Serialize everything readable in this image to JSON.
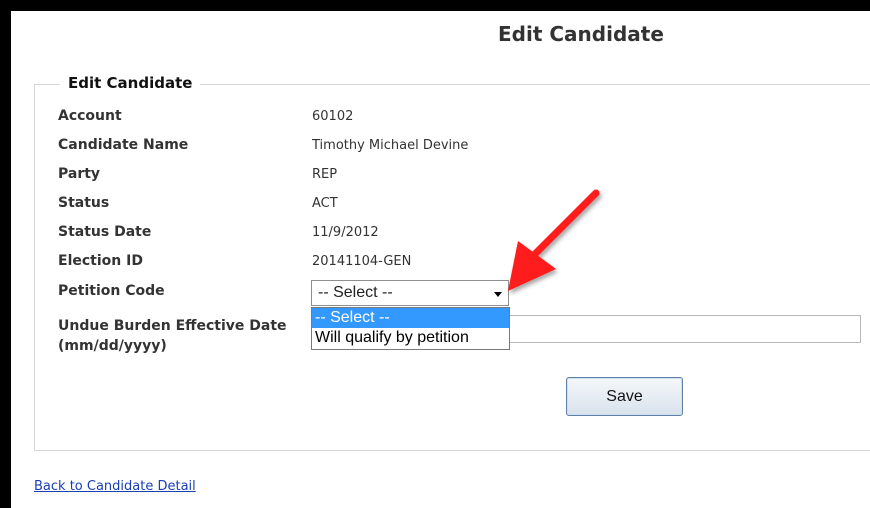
{
  "page": {
    "title": "Edit Candidate",
    "fieldset_legend": "Edit Candidate"
  },
  "fields": [
    {
      "label": "Account",
      "value": "60102"
    },
    {
      "label": "Candidate Name",
      "value": "Timothy Michael Devine"
    },
    {
      "label": "Party",
      "value": "REP"
    },
    {
      "label": "Status",
      "value": "ACT"
    },
    {
      "label": "Status Date",
      "value": "11/9/2012"
    },
    {
      "label": "Election ID",
      "value": "20141104-GEN"
    }
  ],
  "petition_code": {
    "label": "Petition Code",
    "selected": "-- Select --",
    "options": [
      "-- Select --",
      "Will qualify by petition"
    ]
  },
  "undue_burden": {
    "label_line1": "Undue Burden Effective Date",
    "label_line2": "(mm/dd/yyyy)",
    "value": ""
  },
  "actions": {
    "save_label": "Save"
  },
  "back_link": "Back to Candidate Detail",
  "colors": {
    "annotation_arrow": "#ff1a1a",
    "highlight": "#3399ff",
    "link": "#1a3fb3"
  }
}
